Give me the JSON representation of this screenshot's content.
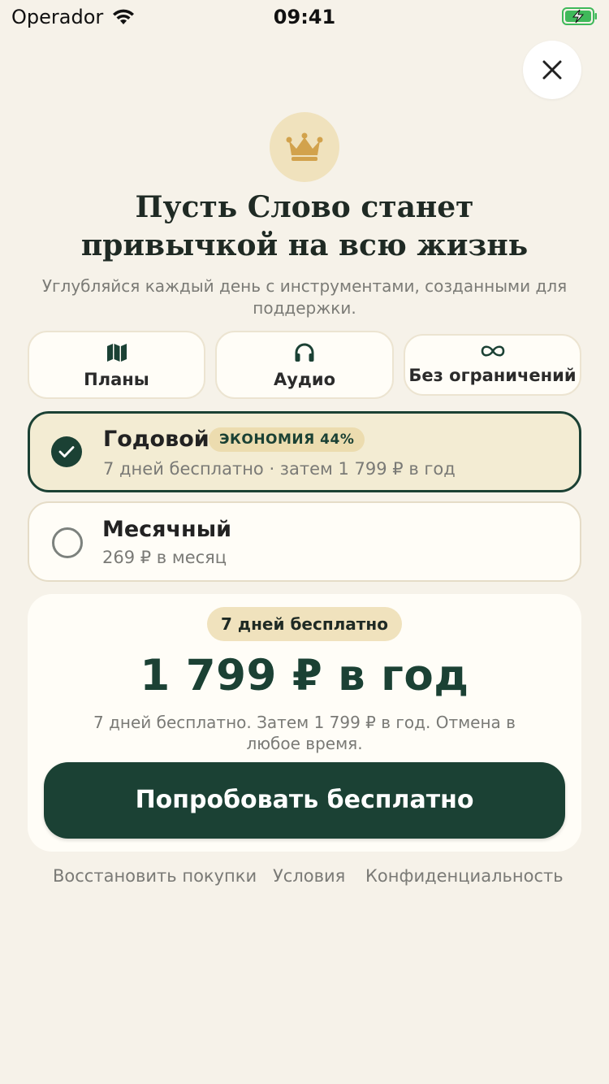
{
  "status_bar": {
    "carrier": "Operador",
    "time": "09:41",
    "battery_charging": true
  },
  "header": {
    "title_line1": "Пусть Слово станет",
    "title_line2": "привычкой на всю жизнь",
    "subtitle": "Углубляйся каждый день с инструментами, созданными для поддержки."
  },
  "features": [
    {
      "label": "Планы",
      "icon": "map-icon"
    },
    {
      "label": "Аудио",
      "icon": "headphones-icon"
    },
    {
      "label": "Без ограничений",
      "icon": "infinity-icon"
    }
  ],
  "plans": {
    "yearly": {
      "title": "Годовой",
      "badge": "ЭКОНОМИЯ 44%",
      "detail": "7 дней бесплатно · затем 1 799 ₽ в год",
      "selected": true
    },
    "monthly": {
      "title": "Месячный",
      "detail": "269 ₽ в месяц",
      "selected": false
    }
  },
  "summary": {
    "trial_label": "7 дней бесплатно",
    "price": "1 799 ₽ в год",
    "note": "7 дней бесплатно. Затем 1 799 ₽ в год. Отмена в любое время.",
    "cta": "Попробовать бесплатно"
  },
  "footer": {
    "restore": "Восстановить покупки",
    "terms": "Условия",
    "privacy": "Конфиденциальность"
  },
  "colors": {
    "background": "#f6f2e9",
    "primary": "#1b4134",
    "accent_gold": "#d2a24c",
    "badge_bg": "#f0e2bd"
  }
}
